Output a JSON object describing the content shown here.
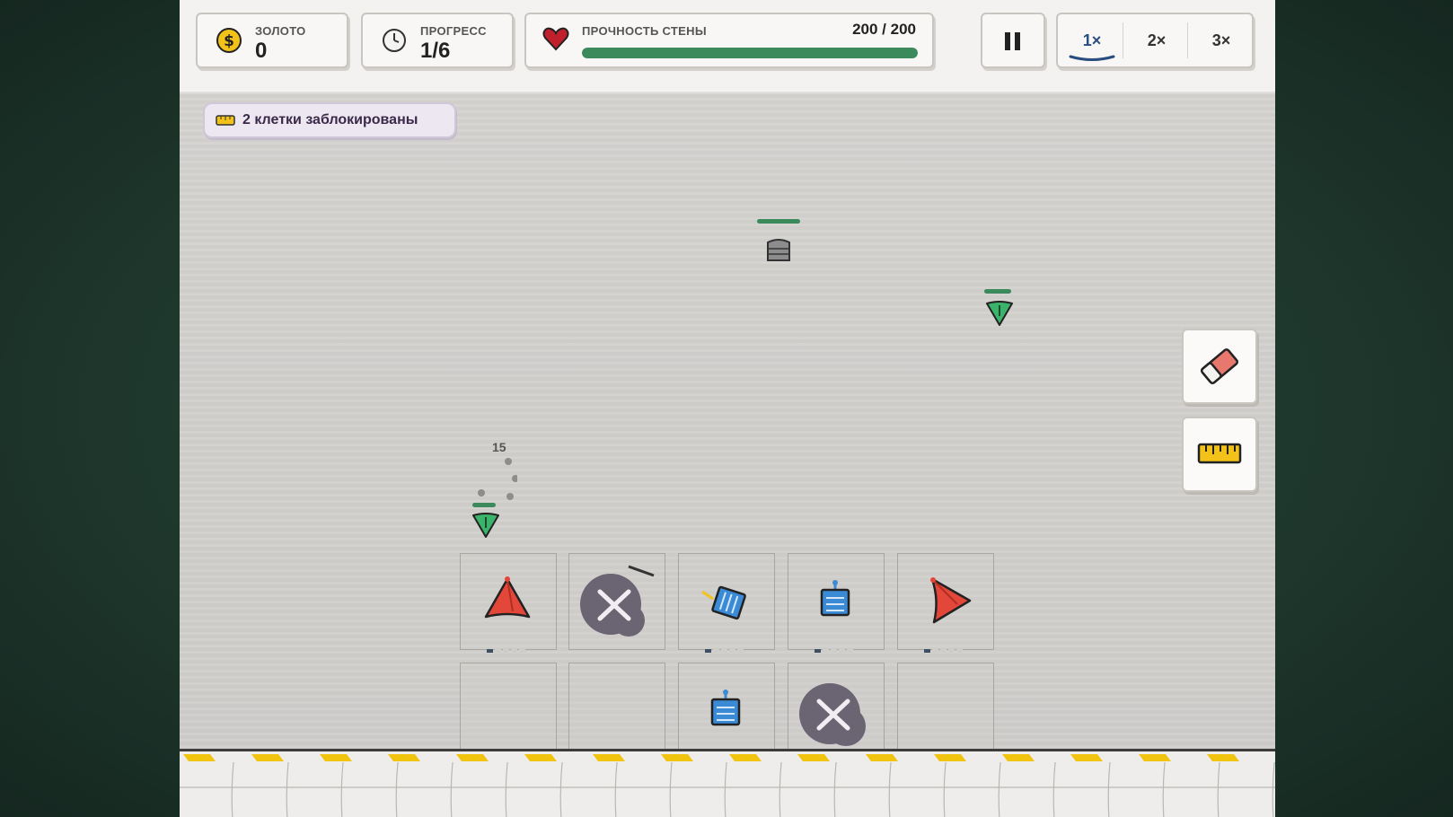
{
  "hud": {
    "gold": {
      "label": "ЗОЛОТО",
      "value": "0"
    },
    "progress": {
      "label": "ПРОГРЕСС",
      "value": "1/6"
    },
    "wall": {
      "label": "ПРОЧНОСТЬ СТЕНЫ",
      "value": "200 / 200",
      "fraction": 1.0
    },
    "pause_icon": "pause-icon",
    "speeds": [
      {
        "label": "1×",
        "active": true
      },
      {
        "label": "2×",
        "active": false
      },
      {
        "label": "3×",
        "active": false
      }
    ]
  },
  "notice": {
    "text": "2 клетки заблокированы",
    "icon": "ruler-icon"
  },
  "tools": [
    {
      "name": "eraser-tool",
      "icon": "eraser-icon"
    },
    {
      "name": "ruler-tool",
      "icon": "ruler-icon"
    }
  ],
  "damage_popup": "15",
  "grid": {
    "row1": [
      {
        "type": "red-cone-tower",
        "level": 1
      },
      {
        "type": "blocked"
      },
      {
        "type": "blue-cannon-tower",
        "level": 1
      },
      {
        "type": "blue-cannon-tower",
        "level": 1
      },
      {
        "type": "red-cone-tower",
        "level": 1
      }
    ],
    "row2": [
      {
        "type": "empty"
      },
      {
        "type": "empty"
      },
      {
        "type": "blue-cannon-tower"
      },
      {
        "type": "blocked"
      },
      {
        "type": "empty"
      }
    ]
  },
  "enemies": [
    {
      "type": "armored-enemy",
      "health": 1.0
    },
    {
      "type": "green-dart-enemy",
      "health": 1.0
    },
    {
      "type": "green-dart-enemy",
      "health": 1.0
    }
  ],
  "colors": {
    "accent": "#2a4d80",
    "health": "#3a8a5c",
    "tower_red": "#e2473a",
    "tower_blue": "#3a8ad6",
    "hazard": "#f1c40f"
  }
}
